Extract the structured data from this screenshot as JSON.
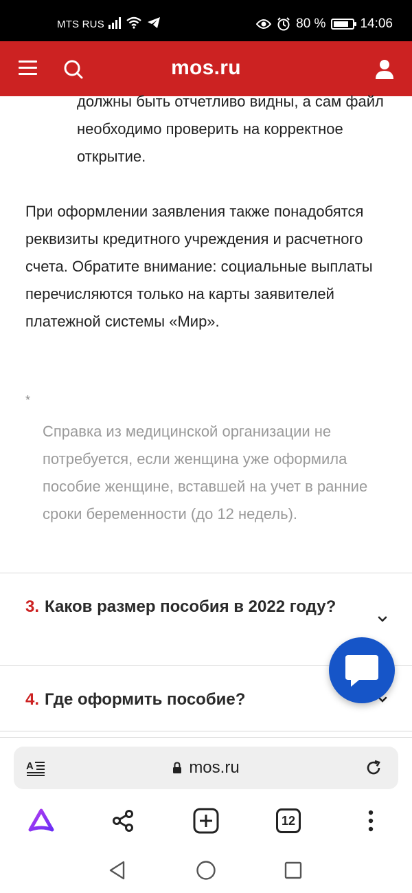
{
  "status_bar": {
    "carrier": "MTS RUS",
    "battery_percent": "80 %",
    "battery_level": 0.8,
    "time": "14:06",
    "icons": [
      "signal-icon",
      "wifi-icon",
      "telegram-icon",
      "eye-icon",
      "alarm-icon",
      "battery-icon"
    ]
  },
  "header": {
    "logo": "mos.ru",
    "icons": [
      "menu-icon",
      "search-icon",
      "user-icon"
    ],
    "background": "#cc2222"
  },
  "article": {
    "list_item_tail": "должны быть отчетливо видны, а сам файл необходимо проверить на корректное открытие.",
    "paragraph": "При оформлении заявления также понадобятся реквизиты кредитного учреждения и расчетного счета. Обратите внимание: социальные выплаты перечисляются только на карты заявителей платежной системы «Мир».",
    "note_marker": "*",
    "note_text": "Справка из медицинской организации не потребуется, если женщина уже оформила пособие женщине, вставшей на учет в ранние сроки беременности (до 12 недель)."
  },
  "accordion": [
    {
      "number": "3.",
      "title": "Каков размер пособия в 2022 году?"
    },
    {
      "number": "4.",
      "title": "Где оформить пособие?"
    }
  ],
  "chat_fab": {
    "icon": "chat-icon",
    "color": "#1655c8"
  },
  "browser": {
    "url": "mos.ru",
    "tab_count": "12",
    "icons": [
      "reader-mode-icon",
      "lock-icon",
      "reload-icon",
      "alice-icon",
      "share-icon",
      "new-tab-icon",
      "tabs-icon",
      "more-icon"
    ]
  },
  "nav_bar": {
    "icons": [
      "back-icon",
      "home-icon",
      "recents-icon"
    ]
  }
}
